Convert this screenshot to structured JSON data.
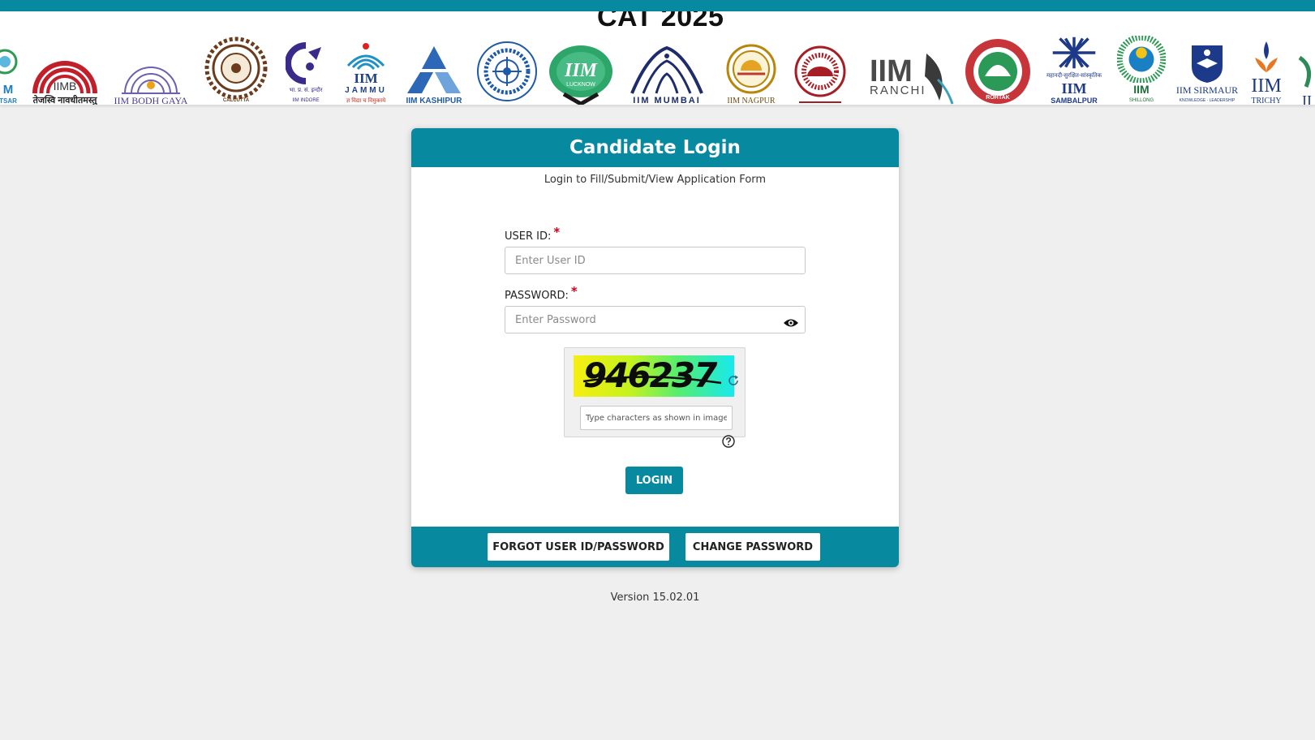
{
  "banner": {
    "title": "CAT 2025",
    "logos": [
      {
        "name": "iim-amritsar-logo",
        "text": "M\nTSAR",
        "color": "#1b7fc4"
      },
      {
        "name": "iim-bangalore-logo",
        "text": "IIMB",
        "subtext": "तेजस्वि नावधीतमस्तु",
        "color": "#b22222"
      },
      {
        "name": "iim-bodh-gaya-logo",
        "text": "IIM BODH GAYA",
        "color": "#4b3b8f"
      },
      {
        "name": "iim-calcutta-logo",
        "text": "CALCUTTA",
        "color": "#6b3b1b"
      },
      {
        "name": "iim-indore-logo",
        "text": "IIM INDORE",
        "color": "#3a2a8a"
      },
      {
        "name": "iim-jammu-logo",
        "text": "IIM",
        "subtext": "JAMMU",
        "color": "#1e6fb4"
      },
      {
        "name": "iim-kashipur-logo",
        "text": "IIM KASHIPUR",
        "color": "#1e5aa8"
      },
      {
        "name": "iim-kozhikode-logo",
        "text": "",
        "color": "#1e5aa8"
      },
      {
        "name": "iim-lucknow-logo",
        "text": "IIM",
        "subtext": "LUCKNOW",
        "color": "#1e8a4a"
      },
      {
        "name": "iim-mumbai-logo",
        "text": "IIM MUMBAI",
        "color": "#1d2c6b"
      },
      {
        "name": "iim-nagpur-logo",
        "text": "IIM NAGPUR",
        "color": "#b8860b"
      },
      {
        "name": "iim-raipur-logo",
        "text": "",
        "color": "#a61d24"
      },
      {
        "name": "iim-ranchi-logo",
        "text": "IIM",
        "subtext": "RANCHI",
        "color": "#444444"
      },
      {
        "name": "iim-rohtak-logo",
        "text": "ROHTAK",
        "color": "#c0392b"
      },
      {
        "name": "iim-sambalpur-logo",
        "text": "IIM",
        "subtext": "SAMBALPUR",
        "color": "#1d3a8a"
      },
      {
        "name": "iim-shillong-logo",
        "text": "IIM",
        "subtext": "SHILLONG",
        "color": "#1e8a4a"
      },
      {
        "name": "iim-sirmaur-logo",
        "text": "IIM SIRMAUR",
        "color": "#1d3a8a"
      },
      {
        "name": "iim-trichy-logo",
        "text": "IIM",
        "subtext": "TRICHY",
        "color": "#1d3a8a"
      },
      {
        "name": "iim-udaipur-logo",
        "text": "II",
        "color": "#2e8b57"
      }
    ]
  },
  "login": {
    "title": "Candidate Login",
    "subtitle": "Login to Fill/Submit/View Application Form",
    "user_id_label": "USER ID:",
    "user_id_placeholder": "Enter User ID",
    "password_label": "PASSWORD:",
    "password_placeholder": "Enter Password",
    "required_mark": "*",
    "captcha_code": "946237",
    "captcha_placeholder": "Type characters as shown in image",
    "login_button": "LOGIN",
    "forgot_button": "FORGOT USER ID/PASSWORD",
    "change_password_button": "CHANGE PASSWORD"
  },
  "footer": {
    "version": "Version 15.02.01"
  },
  "colors": {
    "primary": "#078aa0",
    "required": "#d0021b",
    "background": "#efefef"
  },
  "icons": {
    "password_toggle": "eye-icon",
    "captcha_refresh": "refresh-icon",
    "captcha_help": "question-circle-icon"
  }
}
